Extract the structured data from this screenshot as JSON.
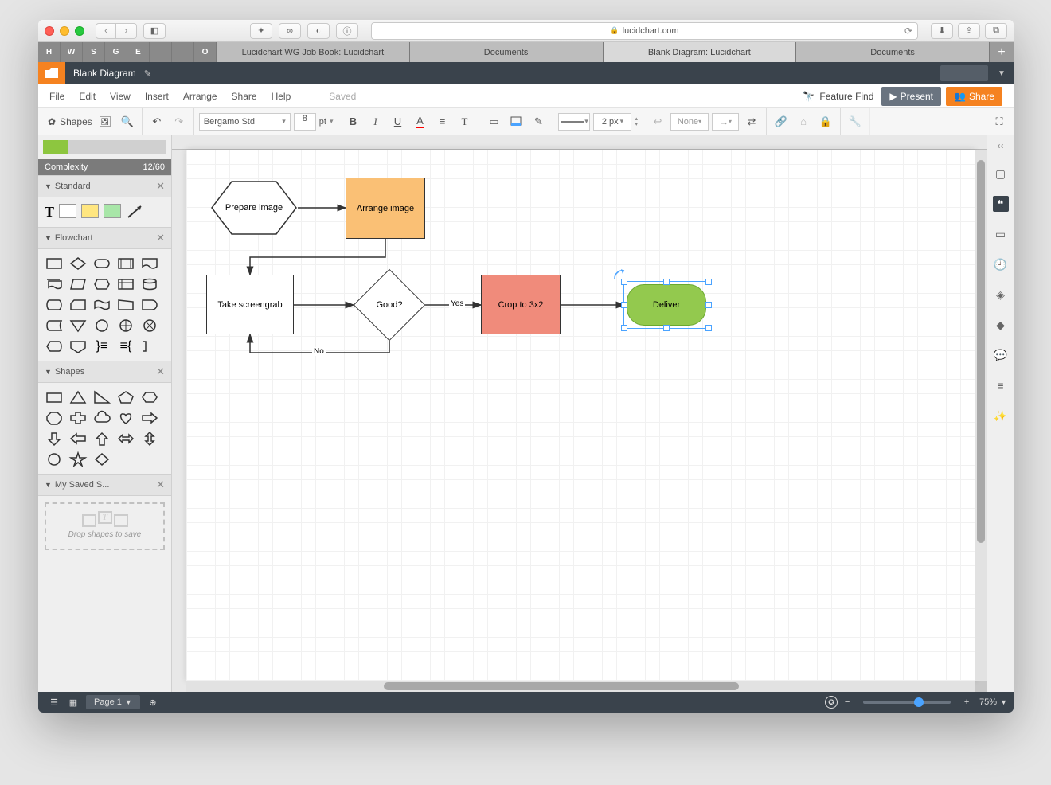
{
  "browser": {
    "url": "lucidchart.com",
    "tabs": [
      "Lucidchart WG Job Book: Lucidchart",
      "Documents",
      "Blank Diagram: Lucidchart",
      "Documents"
    ],
    "active_tab": 2,
    "strip_icons": [
      "H",
      "W",
      "S",
      "G",
      "E",
      "",
      "",
      "O"
    ]
  },
  "app": {
    "doc_title": "Blank Diagram",
    "menu": [
      "File",
      "Edit",
      "View",
      "Insert",
      "Arrange",
      "Share",
      "Help"
    ],
    "saved_label": "Saved",
    "feature_find": "Feature Find",
    "present": "Present",
    "share": "Share"
  },
  "toolbar": {
    "shapes": "Shapes",
    "font": "Bergamo Std",
    "font_size": "8",
    "pt": "pt",
    "line_width": "2 px",
    "arrow_start": "None"
  },
  "left": {
    "complexity_label": "Complexity",
    "complexity_value": "12/60",
    "sections": {
      "standard": "Standard",
      "flowchart": "Flowchart",
      "shapes": "Shapes",
      "saved": "My Saved S..."
    },
    "drop_hint": "Drop shapes to save"
  },
  "canvas": {
    "nodes": {
      "prepare": "Prepare image",
      "arrange": "Arrange image",
      "screengrab": "Take screengrab",
      "good": "Good?",
      "crop": "Crop to 3x2",
      "deliver": "Deliver"
    },
    "edges": {
      "yes": "Yes",
      "no": "No"
    }
  },
  "footer": {
    "page": "Page 1",
    "zoom": "75%"
  }
}
